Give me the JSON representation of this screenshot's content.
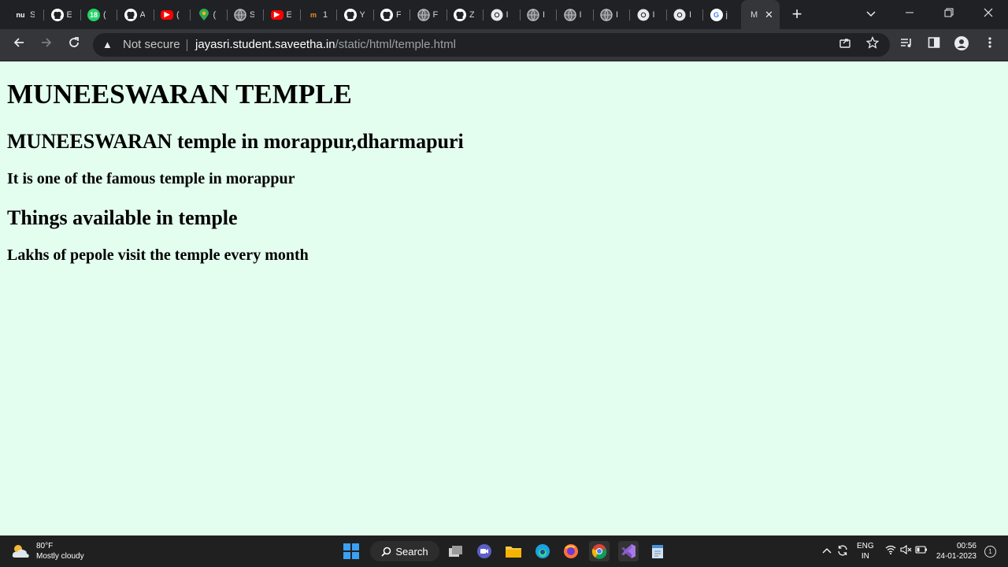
{
  "browser": {
    "tabs": [
      {
        "favicon": "nu-icon",
        "label": "S"
      },
      {
        "favicon": "github-icon",
        "label": "E"
      },
      {
        "favicon": "whatsapp-icon",
        "label": "("
      },
      {
        "favicon": "github-icon",
        "label": "A"
      },
      {
        "favicon": "youtube-icon",
        "label": "("
      },
      {
        "favicon": "maps-icon",
        "label": "("
      },
      {
        "favicon": "globe-icon",
        "label": "S"
      },
      {
        "favicon": "youtube-icon",
        "label": "E"
      },
      {
        "favicon": "nm-icon",
        "label": "1"
      },
      {
        "favicon": "github-icon",
        "label": "Y"
      },
      {
        "favicon": "github-icon",
        "label": "F"
      },
      {
        "favicon": "globe-icon",
        "label": "F"
      },
      {
        "favicon": "github-icon",
        "label": "Z"
      },
      {
        "favicon": "chrome-icon",
        "label": "I"
      },
      {
        "favicon": "globe-icon",
        "label": "I"
      },
      {
        "favicon": "globe-icon",
        "label": "I"
      },
      {
        "favicon": "globe-icon",
        "label": "I"
      },
      {
        "favicon": "chrome-icon",
        "label": "I"
      },
      {
        "favicon": "chrome-icon",
        "label": "I"
      },
      {
        "favicon": "google-icon",
        "label": "j"
      }
    ],
    "active_tab_label": "M",
    "address": {
      "security_label": "Not secure",
      "host": "jayasri.student.saveetha.in",
      "path": "/static/html/temple.html"
    }
  },
  "page": {
    "heading": "MUNEESWARAN TEMPLE",
    "subheading": "MUNEESWARAN temple in morappur,dharmapuri",
    "line1": "It is one of the famous temple in morappur",
    "section_heading": "Things available in temple",
    "line2": "Lakhs of pepole visit the temple every month"
  },
  "taskbar": {
    "weather_temp": "80°F",
    "weather_desc": "Mostly cloudy",
    "search_label": "Search",
    "lang_top": "ENG",
    "lang_bottom": "IN",
    "time": "00:56",
    "date": "24-01-2023",
    "notification_count": "1"
  },
  "colors": {
    "page_background": "#e3fdee",
    "tabstrip": "#202124",
    "toolbar": "#35363a",
    "taskbar": "#202020"
  }
}
